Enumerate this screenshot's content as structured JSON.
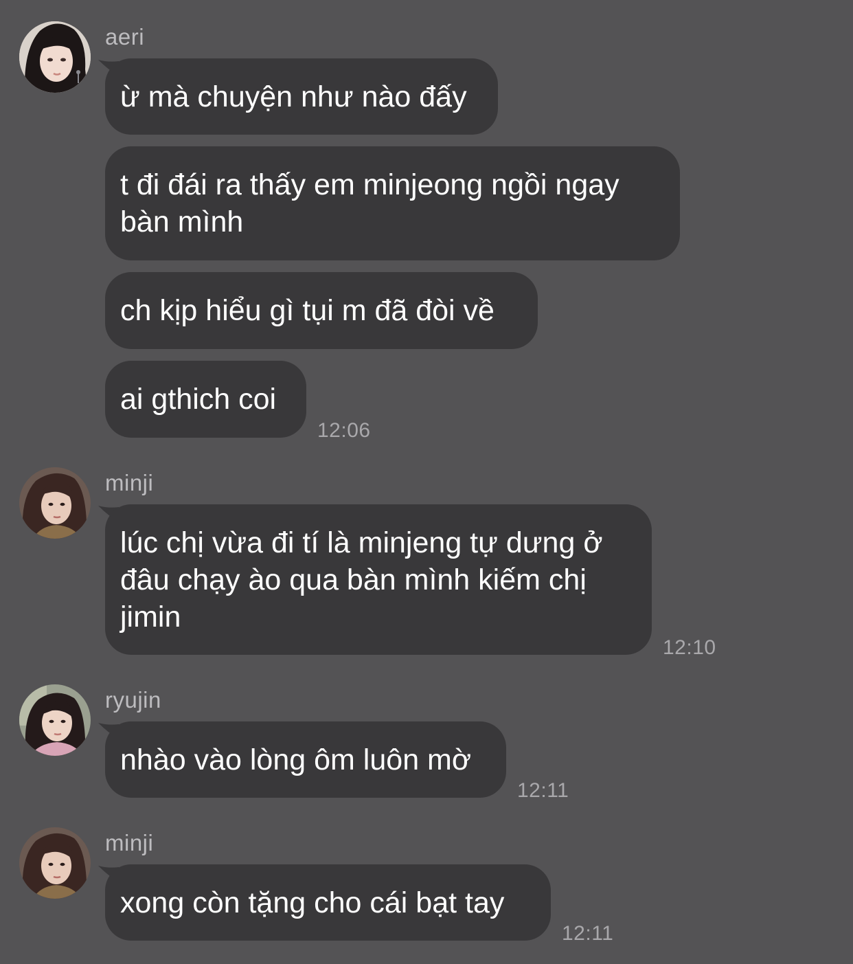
{
  "groups": [
    {
      "sender": "aeri",
      "avatar_icon": "avatar-aeri",
      "messages": [
        "ừ mà chuyện như nào đấy",
        "t đi đái ra thấy em minjeong ngồi ngay|bàn mình",
        "ch kịp hiểu gì tụi m đã đòi về",
        "ai gthich coi"
      ],
      "time": "12:06"
    },
    {
      "sender": "minji",
      "avatar_icon": "avatar-minji",
      "messages": [
        "lúc chị vừa đi tí là minjeng tự dưng ở|đâu chạy ào qua bàn mình kiếm chị|jimin"
      ],
      "time": "12:10"
    },
    {
      "sender": "ryujin",
      "avatar_icon": "avatar-ryujin",
      "messages": [
        "nhào vào lòng ôm luôn mờ"
      ],
      "time": "12:11"
    },
    {
      "sender": "minji",
      "avatar_icon": "avatar-minji",
      "messages": [
        "xong còn tặng cho cái bạt tay"
      ],
      "time": "12:11"
    }
  ],
  "colors": {
    "background": "#545355",
    "bubble": "#39383a",
    "sender_name": "#bdbcbf",
    "timestamp": "#a9a8ab",
    "message_text": "#ffffff"
  }
}
